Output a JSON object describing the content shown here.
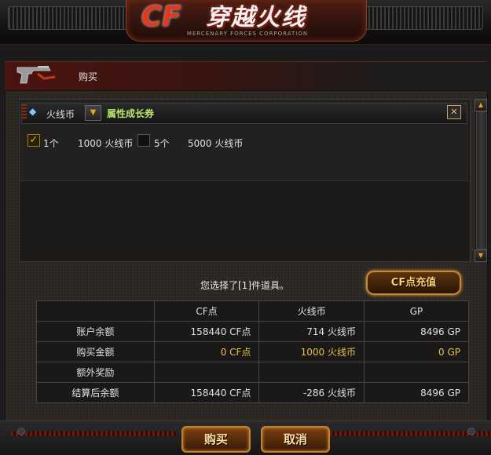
{
  "header": {
    "logo_cf": "CF",
    "logo_cn": "穿越火线",
    "logo_sub": "MERCENARY FORCES CORPORATION"
  },
  "window": {
    "title": "购买"
  },
  "item": {
    "currency": "火线币",
    "name": "属性成长券",
    "options": [
      {
        "qty": "1个",
        "price": "1000 火线币",
        "checked": true
      },
      {
        "qty": "5个",
        "price": "5000 火线币",
        "checked": false
      }
    ]
  },
  "selection": {
    "message": "您选择了[1]件道具。",
    "recharge_label": "CF点充值"
  },
  "table": {
    "headers": [
      "",
      "CF点",
      "火线币",
      "GP"
    ],
    "rows": [
      {
        "label": "账户余额",
        "cf": "158440 CF点",
        "hx": "714 火线币",
        "gp": "8496 GP",
        "highlight": false
      },
      {
        "label": "购买金额",
        "cf": "0 CF点",
        "hx": "1000 火线币",
        "gp": "0 GP",
        "highlight": true
      },
      {
        "label": "额外奖励",
        "cf": "",
        "hx": "",
        "gp": "",
        "highlight": false
      },
      {
        "label": "结算后余额",
        "cf": "158440 CF点",
        "hx": "-286 火线币",
        "gp": "8496 GP",
        "highlight": false
      }
    ]
  },
  "buttons": {
    "buy": "购买",
    "cancel": "取消"
  },
  "icons": {
    "gem": "gem-icon",
    "gun": "pistol-icon",
    "close": "close-icon",
    "dropdown": "triangle-down-icon",
    "scroll_up": "triangle-up-icon",
    "scroll_down": "triangle-down-icon",
    "check": "checkmark-icon",
    "apple": "apple-icon"
  },
  "colors": {
    "item_name": "#b8e66a",
    "highlight_value": "#e8c050",
    "button_border": "#c8802a"
  }
}
